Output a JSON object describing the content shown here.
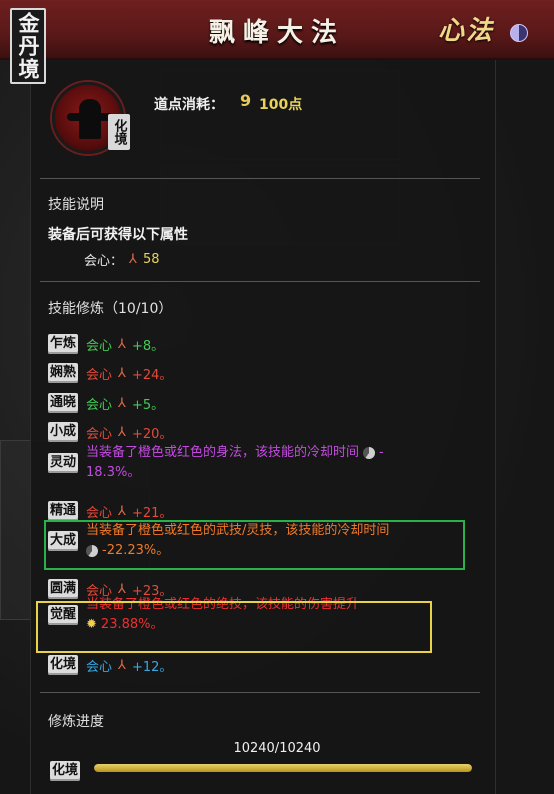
{
  "header": {
    "title": "飘峰大法",
    "realm": "金丹境",
    "category_mark": "心法"
  },
  "skill": {
    "icon_badge": "化境",
    "cost_label": "道点消耗：",
    "cost_icon": "9",
    "cost_value": "100点"
  },
  "description": {
    "title": "技能说明",
    "equip_text": "装备后可获得以下属性",
    "stat_name": "会心：",
    "stat_value": "58"
  },
  "training": {
    "title": "技能修炼（10/10）",
    "levels": [
      {
        "tag": "乍炼",
        "text": "会心",
        "value": "+8。",
        "color": "#44cc55"
      },
      {
        "tag": "娴熟",
        "text": "会心",
        "value": "+24。",
        "color": "#e34a3a"
      },
      {
        "tag": "通晓",
        "text": "会心",
        "value": "+5。",
        "color": "#44cc55"
      },
      {
        "tag": "小成",
        "text": "会心",
        "value": "+20。",
        "color": "#e34a3a"
      },
      {
        "tag": "灵动",
        "line1": "当装备了橙色或红色的身法，该技能的冷却时间",
        "suffix": "-",
        "line2": "18.3%。",
        "color": "#c34be0"
      },
      {
        "tag": "精通",
        "text": "会心",
        "value": "+21。",
        "color": "#e34a3a"
      },
      {
        "tag": "大成",
        "line1": "当装备了橙色或红色的武技/灵技，该技能的冷却时间",
        "line2": "-22.23%。",
        "color": "#f07a2a"
      },
      {
        "tag": "圆满",
        "text": "会心",
        "value": "+23。",
        "color": "#e34a3a"
      },
      {
        "tag": "觉醒",
        "line1": "当装备了橙色或红色的绝技，该技能的伤害提升",
        "line2": "23.88%。",
        "color": "#ee2f2f"
      },
      {
        "tag": "化境",
        "text": "会心",
        "value": "+12。",
        "color": "#3aa6e0"
      }
    ]
  },
  "progress": {
    "title": "修炼进度",
    "text": "10240/10240",
    "tag": "化境",
    "fraction": 1.0
  },
  "colors": {
    "accent_gold": "#e8d25a",
    "header_red": "#6e1f1f"
  },
  "icons": [
    "yin-yang-icon",
    "crit-trident-icon",
    "cooldown-icon",
    "burst-icon"
  ]
}
